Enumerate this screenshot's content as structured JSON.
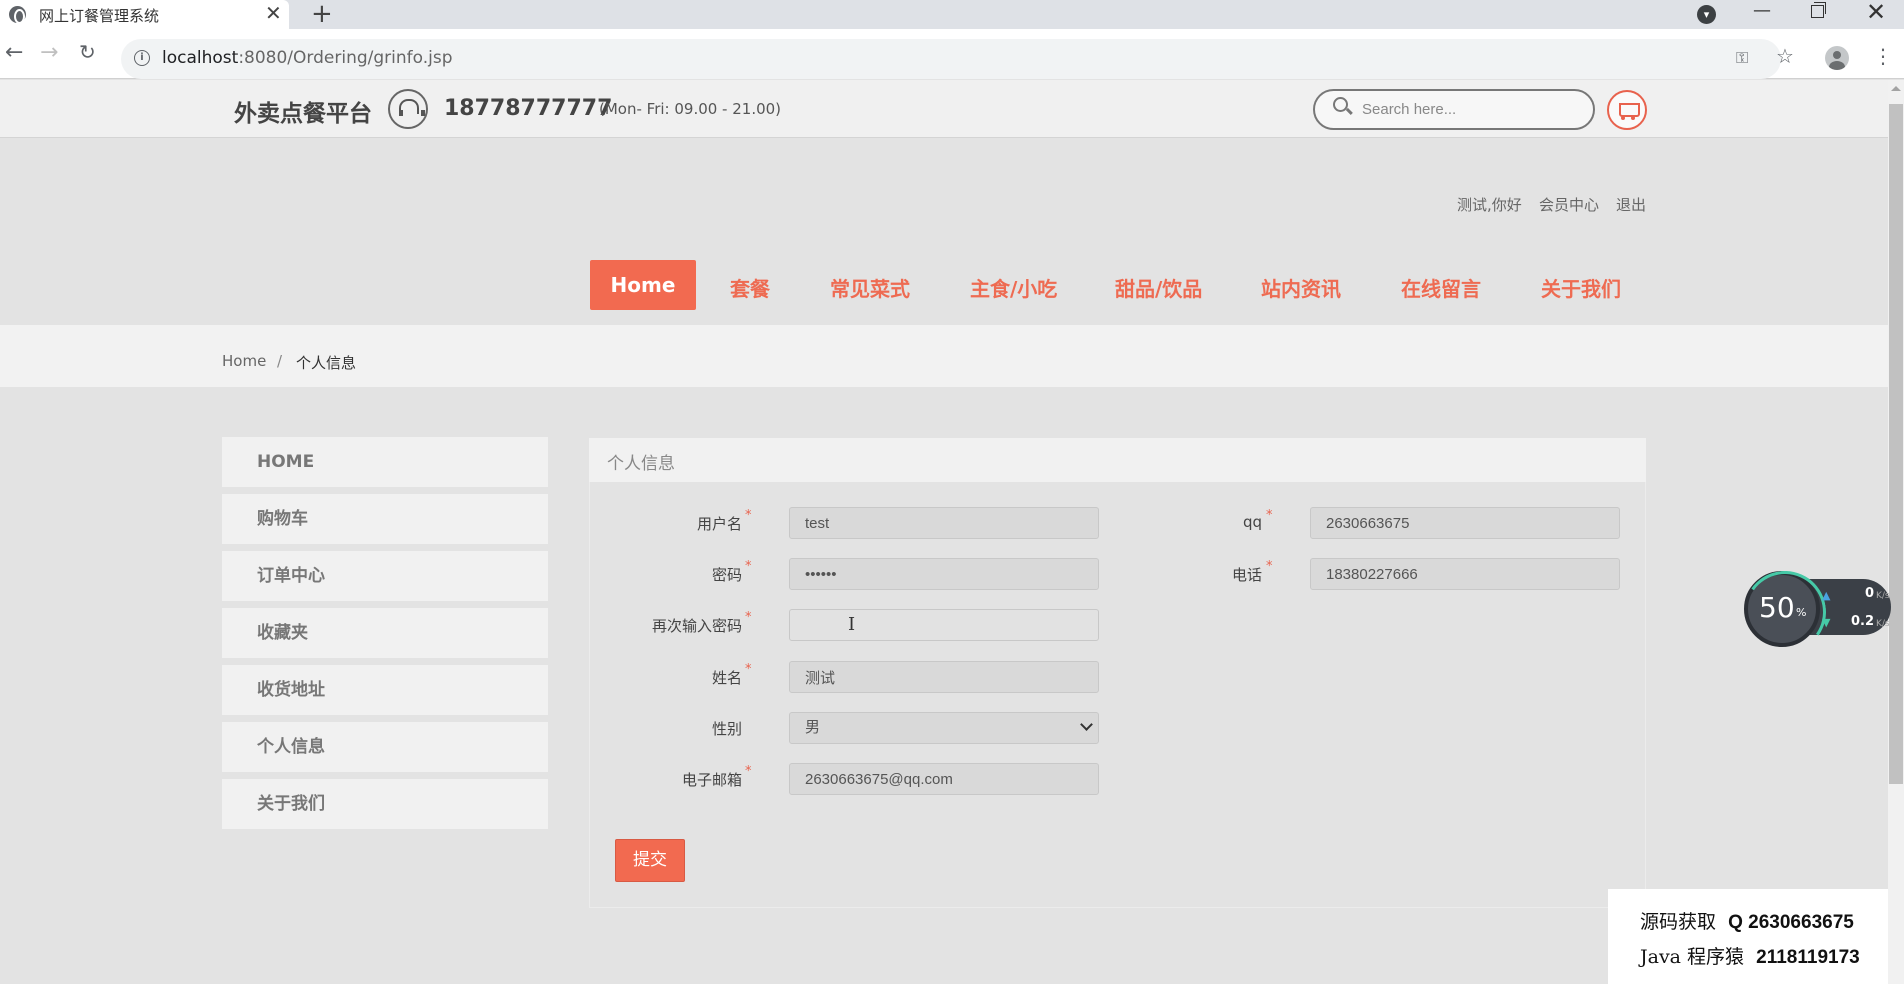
{
  "browser": {
    "tab_title": "网上订餐管理系统",
    "tab_close": "✕",
    "new_tab": "+",
    "url_host": "localhost",
    "url_rest": ":8080/Ordering/grinfo.jsp"
  },
  "header": {
    "site_name": "外卖点餐平台",
    "phone": "18778777777",
    "hours": "(Mon- Fri: 09.00 - 21.00)",
    "search_placeholder": "Search here..."
  },
  "user_links": {
    "greeting": "测试,你好",
    "member_center": "会员中心",
    "logout": "退出"
  },
  "nav": {
    "home": "Home",
    "items": [
      "套餐",
      "常见菜式",
      "主食/小吃",
      "甜品/饮品",
      "站内资讯",
      "在线留言",
      "关于我们"
    ]
  },
  "breadcrumb": {
    "home": "Home",
    "separator": "/",
    "current": "个人信息"
  },
  "sidebar": {
    "items": [
      "HOME",
      "购物车",
      "订单中心",
      "收藏夹",
      "收货地址",
      "个人信息",
      "关于我们"
    ]
  },
  "form": {
    "title": "个人信息",
    "required_mark": "*",
    "username_label": "用户名",
    "username_value": "test",
    "password_label": "密码",
    "password_value": "••••••",
    "confirm_label": "再次输入密码",
    "confirm_value": "",
    "name_label": "姓名",
    "name_value": "测试",
    "gender_label": "性别",
    "gender_value": "男",
    "email_label": "电子邮箱",
    "email_value": "2630663675@qq.com",
    "qq_label": "qq",
    "qq_value": "2630663675",
    "phone_label": "电话",
    "phone_value": "18380227666",
    "submit_label": "提交"
  },
  "speed_widget": {
    "percent": "50",
    "percent_sign": "%",
    "up_speed": "0",
    "down_speed": "0.2",
    "unit": "K/s"
  },
  "watermark": {
    "line1_prefix": "源码获取",
    "line1_value": "Q 2630663675",
    "line2_prefix": "Java 程序猿",
    "line2_value": "2118119173"
  },
  "colors": {
    "accent": "#f26a50",
    "page_bg": "#e3e3e3"
  }
}
